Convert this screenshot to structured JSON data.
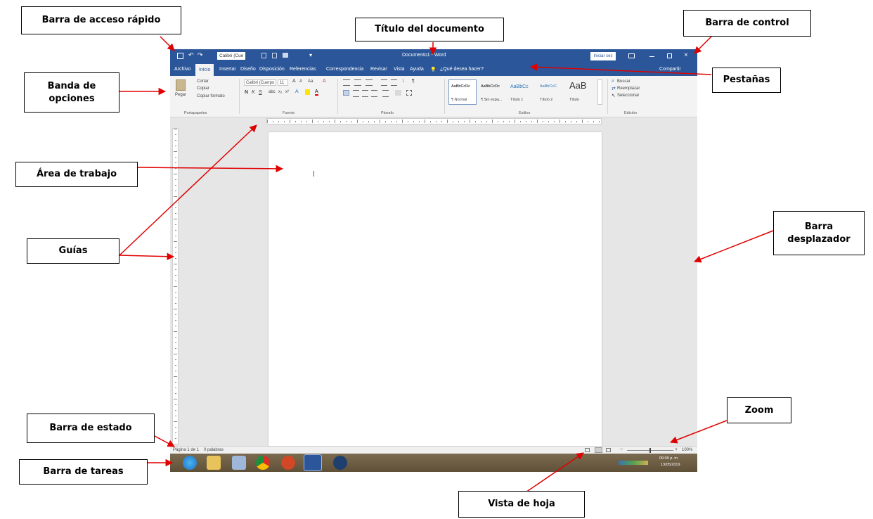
{
  "callouts": {
    "quick_access": "Barra de acceso rápido",
    "document_title": "Título del documento",
    "control_bar": "Barra de control",
    "ribbon_bands_line1": "Banda de",
    "ribbon_bands_line2": "opciones",
    "tabs": "Pestañas",
    "work_area": "Área de trabajo",
    "rulers": "Guías",
    "scrollbar_line1": "Barra",
    "scrollbar_line2": "desplazador",
    "zoom": "Zoom",
    "status_bar": "Barra de estado",
    "taskbar": "Barra de tareas",
    "sheet_view": "Vista de hoja"
  },
  "word": {
    "title": "Documento1 - Word",
    "font_name": "Calibri (Cue",
    "sign_in": "Iniciar ses",
    "tabs": [
      "Archivo",
      "Inicio",
      "Insertar",
      "Diseño",
      "Disposición",
      "Referencias",
      "Correspondencia",
      "Revisar",
      "Vista",
      "Ayuda"
    ],
    "tell_me": "¿Qué desea hacer?",
    "share": "Compartir",
    "ribbon": {
      "clipboard": {
        "paste": "Pegar",
        "cut": "Cortar",
        "copy": "Copiar",
        "format_painter": "Copiar formato",
        "label": "Portapapeles"
      },
      "font": {
        "font": "Calibri (Cuerpo",
        "size": "11",
        "label": "Fuente"
      },
      "paragraph": {
        "label": "Párrafo"
      },
      "styles": {
        "items": [
          {
            "sample": "AaBbCcDc",
            "name": "¶ Normal"
          },
          {
            "sample": "AaBbCcDc",
            "name": "¶ Sin espa..."
          },
          {
            "sample": "AaBbCc",
            "name": "Título 1"
          },
          {
            "sample": "AaBbCcC",
            "name": "Título 2"
          },
          {
            "sample": "AaB",
            "name": "Título"
          }
        ],
        "label": "Estilos"
      },
      "editing": {
        "find": "Buscar",
        "replace": "Reemplazar",
        "select": "Seleccionar",
        "label": "Edición"
      }
    },
    "status": {
      "page": "Página 1 de 1",
      "words": "0 palabras",
      "zoom": "100%"
    },
    "taskbar": {
      "clock_time": "09:09 p. m.",
      "clock_date": "13/05/2019"
    }
  },
  "colors": {
    "word_blue": "#2b579a",
    "arrow_red": "#e00000"
  }
}
